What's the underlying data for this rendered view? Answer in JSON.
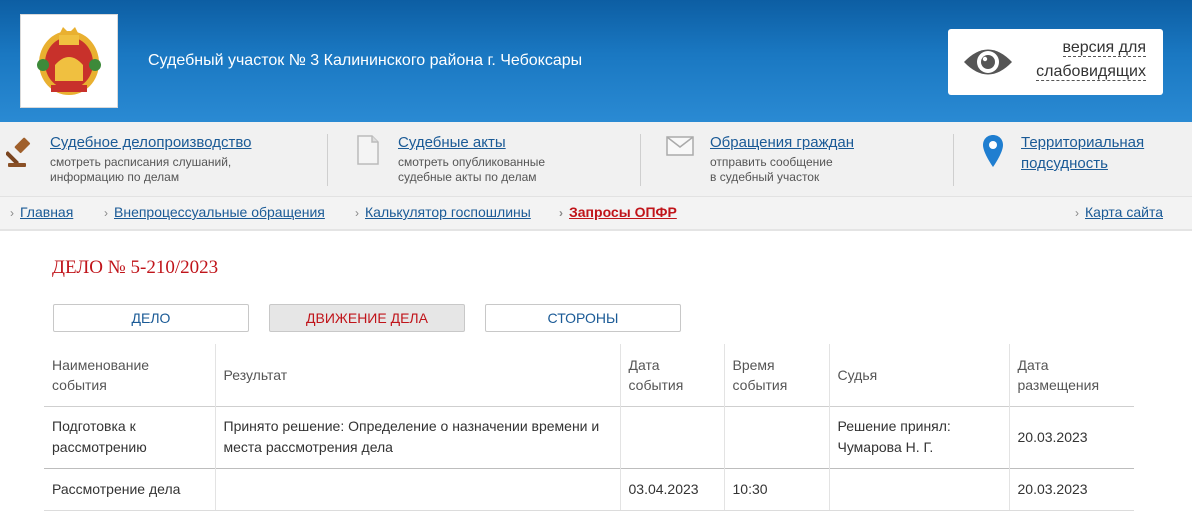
{
  "header": {
    "site_title": "Судебный участок № 3 Калининского района г. Чебоксары",
    "vision_line1": "версия для",
    "vision_line2": "слабовидящих",
    "accent": "#1a78c2"
  },
  "services": [
    {
      "title": "Судебное делопроизводство",
      "desc1": "смотреть расписания слушаний,",
      "desc2": "информацию по делам",
      "icon": "gavel-icon"
    },
    {
      "title": "Судебные акты",
      "desc1": "смотреть опубликованные",
      "desc2": "судебные акты по делам",
      "icon": "document-icon"
    },
    {
      "title": "Обращения граждан",
      "desc1": "отправить сообщение",
      "desc2": "в судебный участок",
      "icon": "envelope-icon"
    },
    {
      "title1": "Территориальная",
      "title2": "подсудность",
      "icon": "map-pin-icon"
    }
  ],
  "nav": {
    "items": [
      "Главная",
      "Внепроцессуальные обращения",
      "Калькулятор госпошлины",
      "Запросы ОПФР"
    ],
    "active": "Запросы ОПФР",
    "sitemap": "Карта сайта"
  },
  "case": {
    "title": "ДЕЛО № 5-210/2023",
    "tabs": [
      "ДЕЛО",
      "ДВИЖЕНИЕ ДЕЛА",
      "СТОРОНЫ"
    ],
    "active_tab": "ДВИЖЕНИЕ ДЕЛА"
  },
  "table": {
    "headers": [
      {
        "l1": "Наименование",
        "l2": "события"
      },
      {
        "l1": "Результат",
        "l2": ""
      },
      {
        "l1": "Дата",
        "l2": "события"
      },
      {
        "l1": "Время",
        "l2": "события"
      },
      {
        "l1": "Судья",
        "l2": ""
      },
      {
        "l1": "Дата",
        "l2": "размещения"
      }
    ],
    "rows": [
      {
        "event1": "Подготовка к",
        "event2": "рассмотрению",
        "result1": "Принято решение: Определение о назначении времени и",
        "result2": "места рассмотрения дела",
        "date": "",
        "time": "",
        "judge1": "Решение принял:",
        "judge2": "Чумарова Н. Г.",
        "posted": "20.03.2023"
      },
      {
        "event1": "Рассмотрение дела",
        "event2": "",
        "result1": "",
        "result2": "",
        "date": "03.04.2023",
        "time": "10:30",
        "judge1": "",
        "judge2": "",
        "posted": "20.03.2023"
      }
    ]
  }
}
